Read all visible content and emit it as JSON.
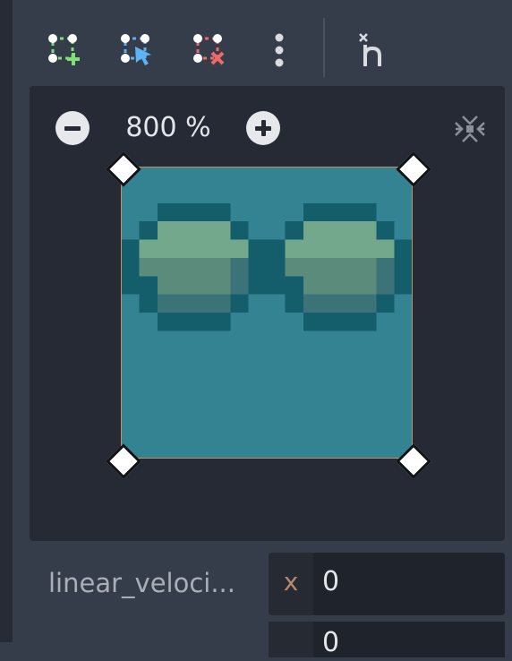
{
  "toolbar": {
    "buttons": [
      {
        "name": "add-point-icon",
        "label": ""
      },
      {
        "name": "select-point-icon",
        "label": ""
      },
      {
        "name": "delete-point-icon",
        "label": ""
      },
      {
        "name": "more-options-icon",
        "label": ""
      },
      {
        "name": "toggle-curve-icon",
        "label": ""
      }
    ]
  },
  "editor": {
    "zoom_label": "800 %",
    "zoom_out_icon": "minus-circle-icon",
    "zoom_in_icon": "plus-circle-icon",
    "center_view_icon": "center-view-icon"
  },
  "colors": {
    "panel_bg": "#363d4a",
    "canvas_bg": "#252a34",
    "sprite_teal": "#338393",
    "lens_dark": "#145e6c",
    "lens_green": "#73a88d",
    "handle": "#ffffff"
  },
  "property": {
    "label": "linear_veloci...",
    "x_axis": "x",
    "x_value": "0",
    "y_value": "0"
  }
}
